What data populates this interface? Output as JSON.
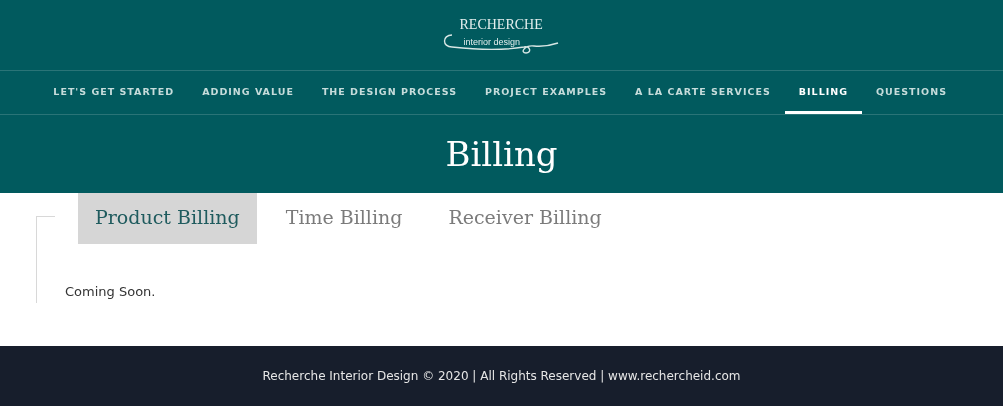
{
  "logo": {
    "name": "RECHERCHE",
    "tagline": "interior design"
  },
  "nav": [
    {
      "label": "LET'S GET STARTED",
      "selected": false
    },
    {
      "label": "ADDING VALUE",
      "selected": false
    },
    {
      "label": "THE DESIGN PROCESS",
      "selected": false
    },
    {
      "label": "PROJECT EXAMPLES",
      "selected": false
    },
    {
      "label": "A LA CARTE SERVICES",
      "selected": false
    },
    {
      "label": "BILLING",
      "selected": true
    },
    {
      "label": "QUESTIONS",
      "selected": false
    }
  ],
  "page_title": "Billing",
  "tabs": [
    {
      "label": "Product Billing",
      "selected": true
    },
    {
      "label": "Time Billing",
      "selected": false
    },
    {
      "label": "Receiver Billing",
      "selected": false
    }
  ],
  "content": "Coming Soon.",
  "footer": "Recherche Interior Design © 2020 | All Rights Reserved | www.rechercheid.com"
}
